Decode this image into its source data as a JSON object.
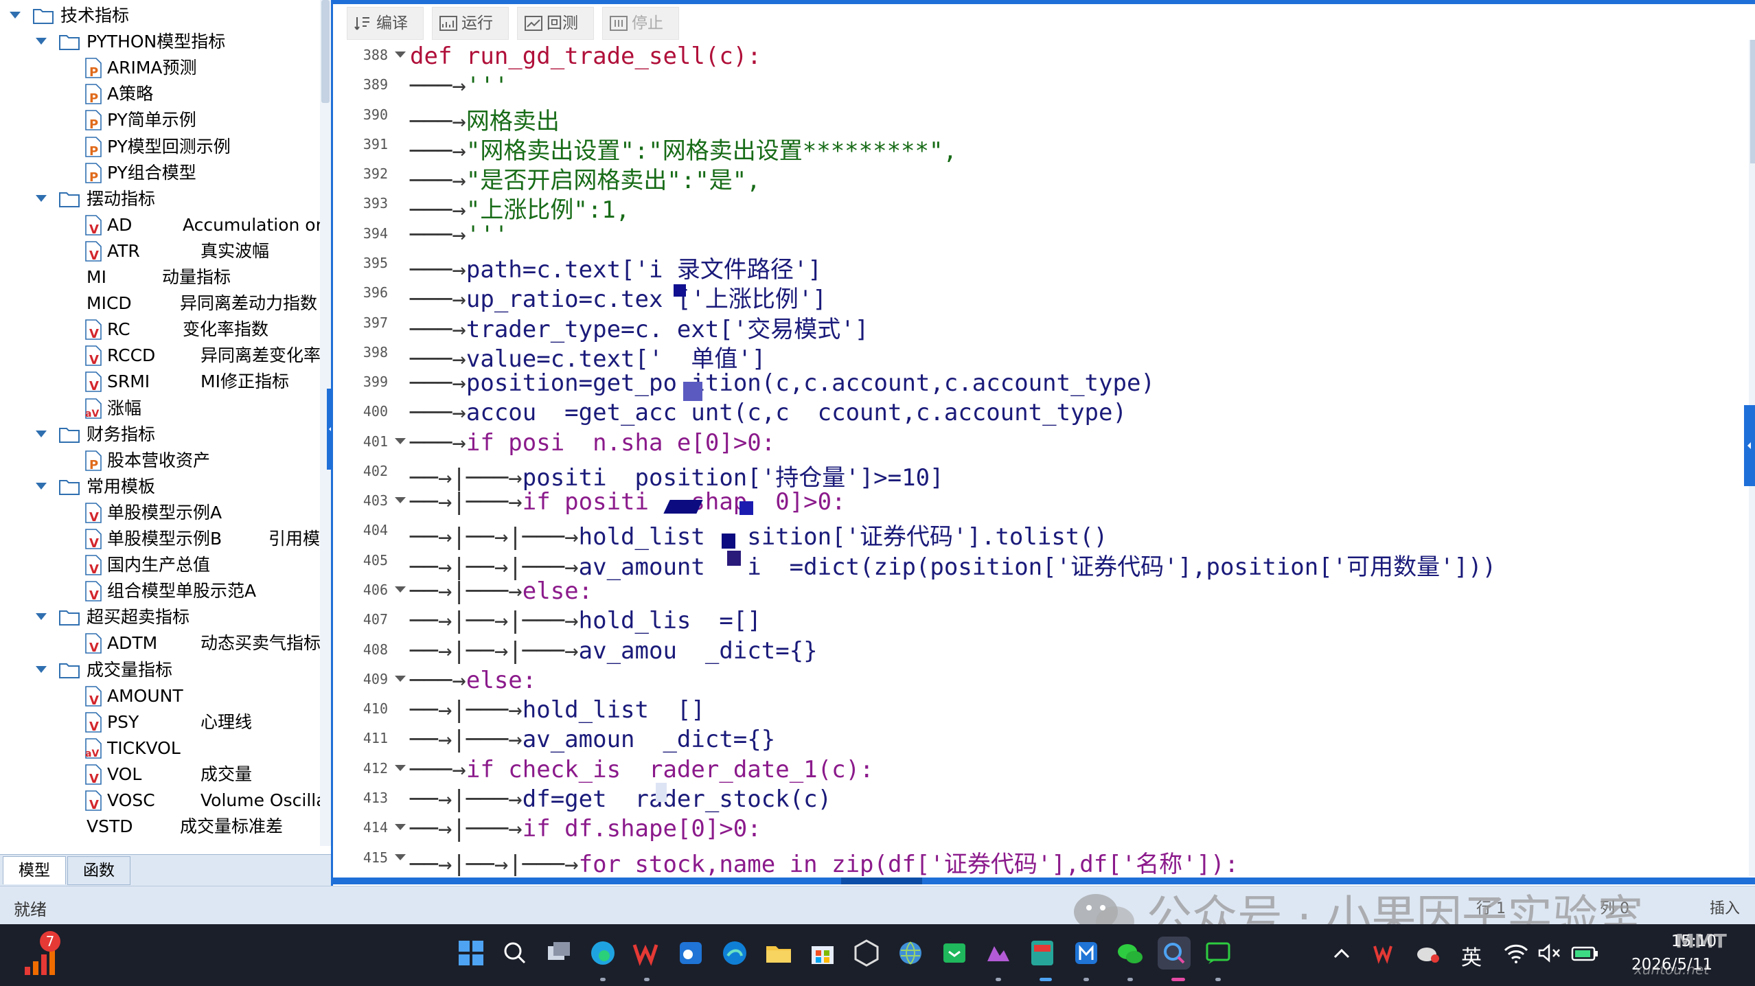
{
  "tree": {
    "items": [
      {
        "label": "技术指标",
        "type": "folder",
        "level": 0,
        "expanded": true
      },
      {
        "label": "PYTHON模型指标",
        "type": "folder",
        "level": 1,
        "expanded": true
      },
      {
        "label": "ARIMA预测",
        "type": "P",
        "level": 2
      },
      {
        "label": "A策略",
        "type": "P",
        "level": 2
      },
      {
        "label": "PY简单示例",
        "type": "P",
        "level": 2
      },
      {
        "label": "PY模型回测示例",
        "type": "P",
        "level": 2
      },
      {
        "label": "PY组合模型",
        "type": "P",
        "level": 2
      },
      {
        "label": "摆动指标",
        "type": "folder",
        "level": 1,
        "expanded": true
      },
      {
        "label": "AD",
        "desc": "Accumulation or",
        "type": "V",
        "level": 2
      },
      {
        "label": "ATR",
        "desc": "真实波幅",
        "type": "V",
        "level": 2
      },
      {
        "label": "MI",
        "desc": "动量指标",
        "type": "none",
        "level": 2
      },
      {
        "label": "MICD",
        "desc": "异同离差动力指数",
        "type": "none",
        "level": 2
      },
      {
        "label": "RC",
        "desc": "变化率指数",
        "type": "V",
        "level": 2
      },
      {
        "label": "RCCD",
        "desc": "异同离差变化率",
        "type": "V",
        "level": 2
      },
      {
        "label": "SRMI",
        "desc": "MI修正指标",
        "type": "V",
        "level": 2
      },
      {
        "label": "涨幅",
        "type": "aV",
        "level": 2
      },
      {
        "label": "财务指标",
        "type": "folder",
        "level": 1,
        "expanded": true
      },
      {
        "label": "股本营收资产",
        "type": "P",
        "level": 2
      },
      {
        "label": "常用模板",
        "type": "folder",
        "level": 1,
        "expanded": true
      },
      {
        "label": "单股模型示例A",
        "type": "V",
        "level": 2
      },
      {
        "label": "单股模型示例B",
        "desc": "引用模",
        "type": "V",
        "level": 2
      },
      {
        "label": "国内生产总值",
        "type": "V",
        "level": 2
      },
      {
        "label": "组合模型单股示范A",
        "type": "V",
        "level": 2
      },
      {
        "label": "超买超卖指标",
        "type": "folder",
        "level": 1,
        "expanded": true
      },
      {
        "label": "ADTM",
        "desc": "动态买卖气指标",
        "type": "V",
        "level": 2
      },
      {
        "label": "成交量指标",
        "type": "folder",
        "level": 1,
        "expanded": true
      },
      {
        "label": "AMOUNT",
        "type": "V",
        "level": 2
      },
      {
        "label": "PSY",
        "desc": "心理线",
        "type": "V",
        "level": 2
      },
      {
        "label": "TICKVOL",
        "type": "aV",
        "level": 2
      },
      {
        "label": "VOL",
        "desc": "成交量",
        "type": "V",
        "level": 2
      },
      {
        "label": "VOSC",
        "desc": "Volume Oscilla",
        "type": "V",
        "level": 2
      },
      {
        "label": "VSTD",
        "desc": "成交量标准差",
        "type": "none",
        "level": 2
      }
    ]
  },
  "left_tabs": {
    "model": "模型",
    "function": "函数"
  },
  "toolbar": {
    "compile": "编译",
    "run": "运行",
    "backtest": "回测",
    "stop": "停止"
  },
  "code_lines": [
    {
      "n": "388",
      "fold": true,
      "indent": 0,
      "code": "def run_gd_trade_sell(c):"
    },
    {
      "n": "389",
      "fold": false,
      "indent": 1,
      "code": "'''"
    },
    {
      "n": "390",
      "fold": false,
      "indent": 1,
      "code": "网格卖出"
    },
    {
      "n": "391",
      "fold": false,
      "indent": 1,
      "code": "\"网格卖出设置\":\"网格卖出设置*********\","
    },
    {
      "n": "392",
      "fold": false,
      "indent": 1,
      "code": "\"是否开启网格卖出\":\"是\","
    },
    {
      "n": "393",
      "fold": false,
      "indent": 1,
      "code": "\"上涨比例\":1,"
    },
    {
      "n": "394",
      "fold": false,
      "indent": 1,
      "code": "'''"
    },
    {
      "n": "395",
      "fold": false,
      "indent": 1,
      "code": "path=c.text['i 录文件路径']"
    },
    {
      "n": "396",
      "fold": false,
      "indent": 1,
      "code": "up_ratio=c.tex ['上涨比例']"
    },
    {
      "n": "397",
      "fold": false,
      "indent": 1,
      "code": "trader_type=c. ext['交易模式']"
    },
    {
      "n": "398",
      "fold": false,
      "indent": 1,
      "code": "value=c.text['  单值']"
    },
    {
      "n": "399",
      "fold": false,
      "indent": 1,
      "code": "position=get_po ition(c,c.account,c.account_type)"
    },
    {
      "n": "400",
      "fold": false,
      "indent": 1,
      "code": "accou  =get_acc unt(c,c  ccount,c.account_type)"
    },
    {
      "n": "401",
      "fold": true,
      "indent": 1,
      "code": "if posi  n.sha e[0]>0:"
    },
    {
      "n": "402",
      "fold": false,
      "indent": 2,
      "code": "positi  position['持仓量']>=10]"
    },
    {
      "n": "403",
      "fold": true,
      "indent": 2,
      "code": "if positi   shap  0]>0:"
    },
    {
      "n": "404",
      "fold": false,
      "indent": 3,
      "code": "hold_list   sition['证券代码'].tolist()"
    },
    {
      "n": "405",
      "fold": false,
      "indent": 3,
      "code": "av_amount   i  =dict(zip(position['证券代码'],position['可用数量']))"
    },
    {
      "n": "406",
      "fold": true,
      "indent": 2,
      "code": "else:"
    },
    {
      "n": "407",
      "fold": false,
      "indent": 3,
      "code": "hold_lis  =[]"
    },
    {
      "n": "408",
      "fold": false,
      "indent": 3,
      "code": "av_amou  _dict={}"
    },
    {
      "n": "409",
      "fold": true,
      "indent": 1,
      "code": "else:"
    },
    {
      "n": "410",
      "fold": false,
      "indent": 2,
      "code": "hold_list  []"
    },
    {
      "n": "411",
      "fold": false,
      "indent": 2,
      "code": "av_amoun  _dict={}"
    },
    {
      "n": "412",
      "fold": true,
      "indent": 1,
      "code": "if check_is  rader_date_1(c):"
    },
    {
      "n": "413",
      "fold": false,
      "indent": 2,
      "code": "df=get  rader_stock(c)"
    },
    {
      "n": "414",
      "fold": true,
      "indent": 2,
      "code": "if df.shape[0]>0:"
    },
    {
      "n": "415",
      "fold": true,
      "indent": 3,
      "code": "for stock,name in zip(df['证券代码'],df['名称']):"
    }
  ],
  "status": {
    "text": "就绪",
    "row": "行 1",
    "col": "列 0",
    "mode": "插入"
  },
  "watermark": "公众号 · 小果因子实验室",
  "taskbar": {
    "badge": "7",
    "lang": "英",
    "time": "15:10",
    "date": "2026/5/11",
    "corner_mark": "MMT",
    "corner_site": "xuntou.net"
  },
  "colors": {
    "accent": "#1f6fd8",
    "keyword": "#8b1a8b",
    "function": "#b0103a",
    "string": "#176b17",
    "identifier": "#1a1a7a"
  }
}
